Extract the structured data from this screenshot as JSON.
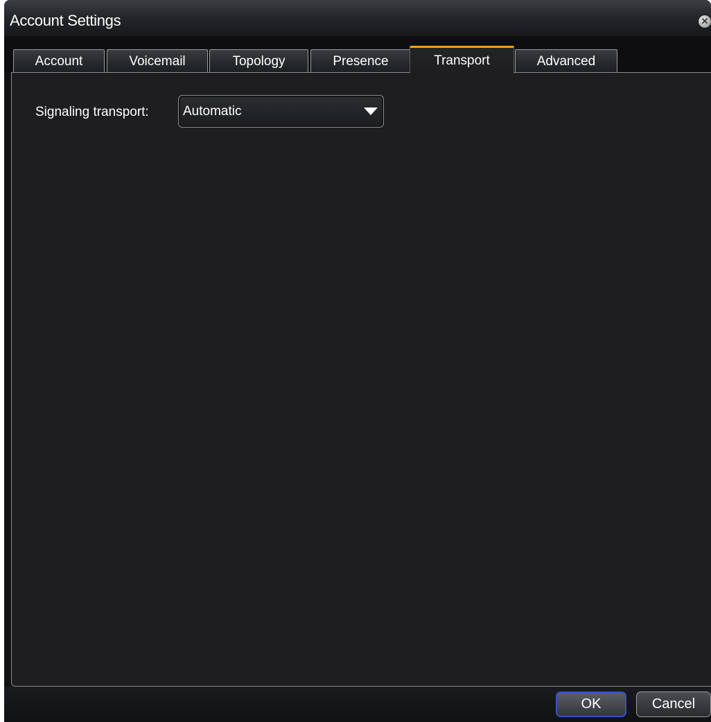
{
  "window": {
    "title": "Account Settings"
  },
  "tabs": [
    {
      "label": "Account",
      "active": false
    },
    {
      "label": "Voicemail",
      "active": false
    },
    {
      "label": "Topology",
      "active": false
    },
    {
      "label": "Presence",
      "active": false
    },
    {
      "label": "Transport",
      "active": true
    },
    {
      "label": "Advanced",
      "active": false
    }
  ],
  "transport": {
    "signaling_label": "Signaling transport:",
    "signaling_value": "Automatic"
  },
  "buttons": {
    "ok": "OK",
    "cancel": "Cancel"
  },
  "icons": {
    "close": "close-icon",
    "dropdown": "chevron-down-icon"
  },
  "colors": {
    "active_tab_accent": "#f0a21e",
    "default_button_border": "#2f54c7",
    "background": "#1e1e21"
  }
}
